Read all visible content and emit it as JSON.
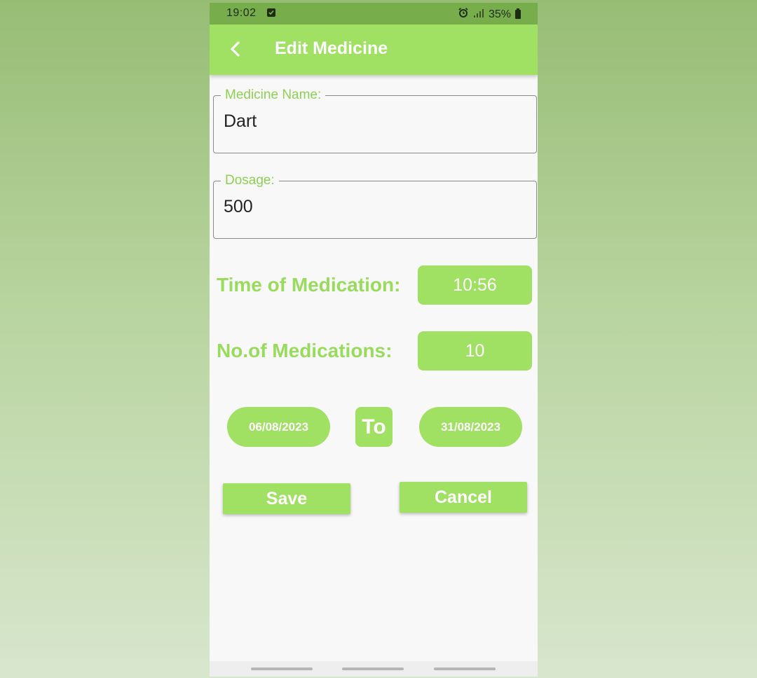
{
  "status_bar": {
    "time": "19:02",
    "battery": "35%"
  },
  "app_bar": {
    "title": "Edit Medicine"
  },
  "form": {
    "medicine_name_label": "Medicine Name:",
    "medicine_name_value": "Dart",
    "dosage_label": "Dosage:",
    "dosage_value": "500",
    "time_label": "Time of Medication:",
    "time_value": "10:56",
    "count_label": "No.of Medications:",
    "count_value": "10",
    "start_date": "06/08/2023",
    "to_label": "To",
    "end_date": "31/08/2023"
  },
  "actions": {
    "save_label": "Save",
    "cancel_label": "Cancel"
  },
  "colors": {
    "accent": "#a0e062",
    "status_bar": "#78ad4c",
    "label_green": "#99dc5d"
  }
}
